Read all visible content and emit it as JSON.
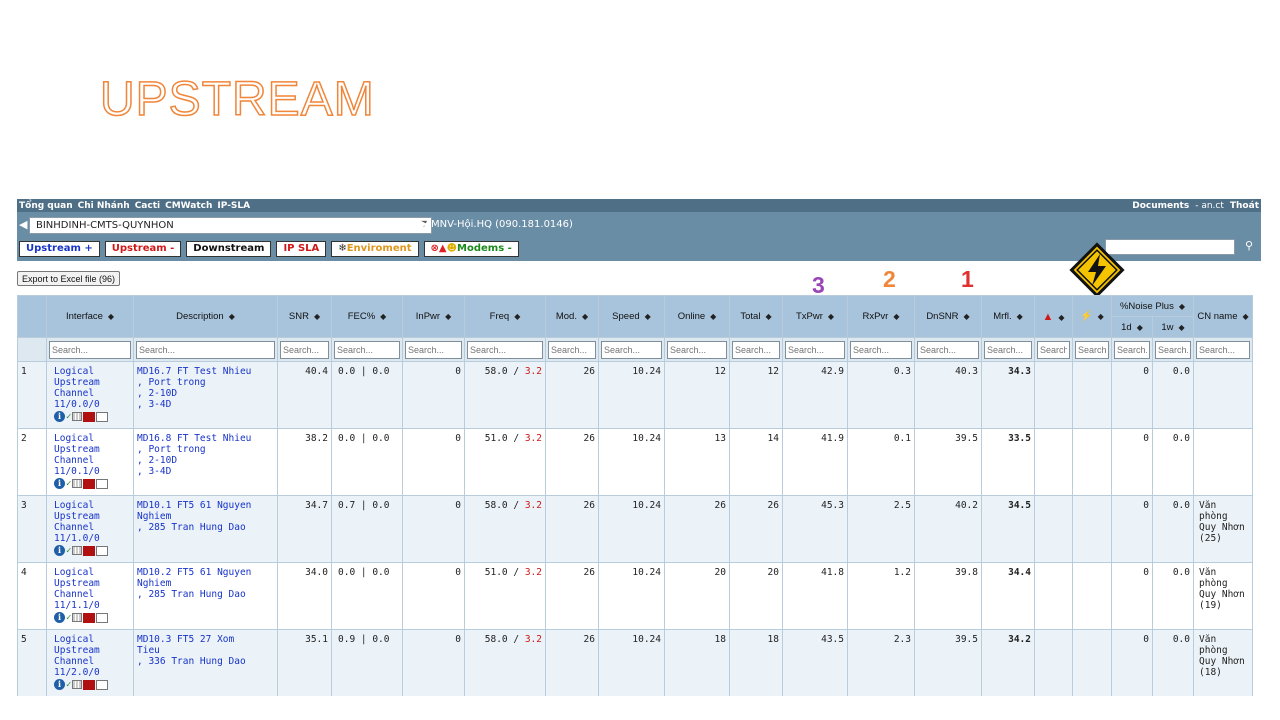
{
  "slide_title": "UPSTREAM",
  "topnav": {
    "items": [
      "Tổng quan",
      "Chi Nhánh",
      "Cacti",
      "CMWatch",
      "IP-SLA"
    ],
    "documents": "Documents",
    "user": "- an.ct",
    "logout": "Thoát"
  },
  "toolbar": {
    "cmts_value": "BINHDINH-CMTS-QUYNHON",
    "location": "MNV-Hội.HQ (090.181.0146)",
    "buttons": {
      "upstream_plus": "Upstream +",
      "upstream_minus": "Upstream -",
      "downstream": "Downstream",
      "ip_sla": "IP SLA",
      "environment": "Enviroment",
      "modems": "Modems -"
    }
  },
  "export_label": "Export to Excel file (96)",
  "badges": [
    "3",
    "2",
    "1"
  ],
  "colors": {
    "header_bg": "#a8c4dc",
    "nav_bg": "#4f6f87",
    "toolbar_bg": "#6a8da6",
    "title_orange": "#f0863a",
    "alert_red": "#d01818",
    "link_blue": "#1834c8"
  },
  "icons": {
    "sign": "lightning-warning-sign-icon",
    "alarm": "warning-triangle-icon",
    "power": "lightning-icon"
  },
  "columns": {
    "interface": "Interface",
    "description": "Description",
    "snr": "SNR",
    "fec": "FEC%",
    "inpwr": "InPwr",
    "freq": "Freq",
    "mod": "Mod.",
    "speed": "Speed",
    "online": "Online",
    "total": "Total",
    "txpwr": "TxPwr",
    "rxpwr": "RxPvr",
    "dnsnr": "DnSNR",
    "mrfl": "Mrfl.",
    "noise": "%Noise Plus",
    "noise_1d": "1d",
    "noise_1w": "1w",
    "cn_name": "CN name"
  },
  "search_placeholder": "Search...",
  "rows": [
    {
      "idx": "1",
      "iface": [
        "Logical",
        "Upstream",
        "Channel",
        "11/0.0/0"
      ],
      "desc": [
        "MD16.7 FT Test Nhieu",
        ", Port trong",
        ", 2-10D",
        ", 3-4D"
      ],
      "snr": "40.4",
      "fec": "0.0 | 0.0",
      "inpwr": "0",
      "freq_a": "58.0 /",
      "freq_b": "3.2",
      "mod": "26",
      "speed": "10.24",
      "online": "12",
      "total": "12",
      "txpwr": "42.9",
      "rxpwr": "0.3",
      "dnsnr": "40.3",
      "mrfl": "34.3",
      "n1d": "0",
      "n1w": "0.0",
      "cn": []
    },
    {
      "idx": "2",
      "iface": [
        "Logical",
        "Upstream",
        "Channel",
        "11/0.1/0"
      ],
      "desc": [
        "MD16.8 FT Test Nhieu",
        ", Port trong",
        ", 2-10D",
        ", 3-4D"
      ],
      "snr": "38.2",
      "fec": "0.0 | 0.0",
      "inpwr": "0",
      "freq_a": "51.0 /",
      "freq_b": "3.2",
      "mod": "26",
      "speed": "10.24",
      "online": "13",
      "total": "14",
      "txpwr": "41.9",
      "rxpwr": "0.1",
      "dnsnr": "39.5",
      "mrfl": "33.5",
      "n1d": "0",
      "n1w": "0.0",
      "cn": []
    },
    {
      "idx": "3",
      "iface": [
        "Logical",
        "Upstream",
        "Channel",
        "11/1.0/0"
      ],
      "desc": [
        "MD10.1 FT5 61 Nguyen",
        "Nghiem",
        ", 285 Tran Hung Dao"
      ],
      "snr": "34.7",
      "fec": "0.7 | 0.0",
      "inpwr": "0",
      "freq_a": "58.0 /",
      "freq_b": "3.2",
      "mod": "26",
      "speed": "10.24",
      "online": "26",
      "total": "26",
      "txpwr": "45.3",
      "rxpwr": "2.5",
      "dnsnr": "40.2",
      "mrfl": "34.5",
      "n1d": "0",
      "n1w": "0.0",
      "cn": [
        "Văn",
        "phòng",
        "Quy Nhơn",
        "(25)"
      ]
    },
    {
      "idx": "4",
      "iface": [
        "Logical",
        "Upstream",
        "Channel",
        "11/1.1/0"
      ],
      "desc": [
        "MD10.2 FT5 61 Nguyen",
        "Nghiem",
        ", 285 Tran Hung Dao"
      ],
      "snr": "34.0",
      "fec": "0.0 | 0.0",
      "inpwr": "0",
      "freq_a": "51.0 /",
      "freq_b": "3.2",
      "mod": "26",
      "speed": "10.24",
      "online": "20",
      "total": "20",
      "txpwr": "41.8",
      "rxpwr": "1.2",
      "dnsnr": "39.8",
      "mrfl": "34.4",
      "n1d": "0",
      "n1w": "0.0",
      "cn": [
        "Văn",
        "phòng",
        "Quy Nhơn",
        "(19)"
      ]
    },
    {
      "idx": "5",
      "iface": [
        "Logical",
        "Upstream",
        "Channel",
        "11/2.0/0"
      ],
      "desc": [
        "MD10.3 FT5 27 Xom",
        "Tieu",
        ", 336 Tran Hung Dao"
      ],
      "snr": "35.1",
      "fec": "0.9 | 0.0",
      "inpwr": "0",
      "freq_a": "58.0 /",
      "freq_b": "3.2",
      "mod": "26",
      "speed": "10.24",
      "online": "18",
      "total": "18",
      "txpwr": "43.5",
      "rxpwr": "2.3",
      "dnsnr": "39.5",
      "mrfl": "34.2",
      "n1d": "0",
      "n1w": "0.0",
      "cn": [
        "Văn",
        "phòng",
        "Quy Nhơn",
        "(18)"
      ]
    }
  ]
}
